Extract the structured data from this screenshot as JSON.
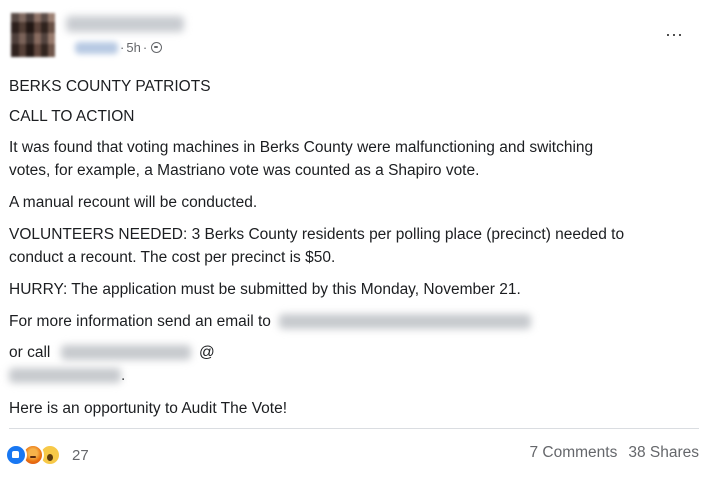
{
  "header": {
    "timestamp": "5h",
    "separator": "·",
    "visibility_icon": "globe-icon",
    "more_icon": "more-options-icon",
    "more_label": "···"
  },
  "post": {
    "title": "BERKS COUNTY PATRIOTS",
    "subtitle": "CALL TO ACTION",
    "para1_line1": "It was found that voting machines in Berks County were malfunctioning and switching",
    "para1_line2": "votes, for example, a Mastriano vote was counted as a Shapiro vote.",
    "para2": "A manual recount will be conducted.",
    "para3_line1": "VOLUNTEERS NEEDED:  3 Berks County residents per polling place (precinct) needed to",
    "para3_line2": "conduct a recount. The cost per precinct is $50.",
    "para4": "HURRY: The application must be submitted by this Monday, November 21.",
    "para5_prefix": "For more information send an email to",
    "para6_prefix": "or call",
    "para6_at": "@",
    "para7_suffix": ".",
    "para8": "Here is an opportunity to Audit The Vote!"
  },
  "footer": {
    "reaction_icons": [
      "like-icon",
      "angry-icon",
      "wow-icon"
    ],
    "reaction_count": "27",
    "comments": "7 Comments",
    "shares": "38 Shares"
  },
  "colors": {
    "text": "#1c1e21",
    "secondary": "#65676b",
    "like_blue": "#1877f2",
    "divider": "#dadde1"
  }
}
